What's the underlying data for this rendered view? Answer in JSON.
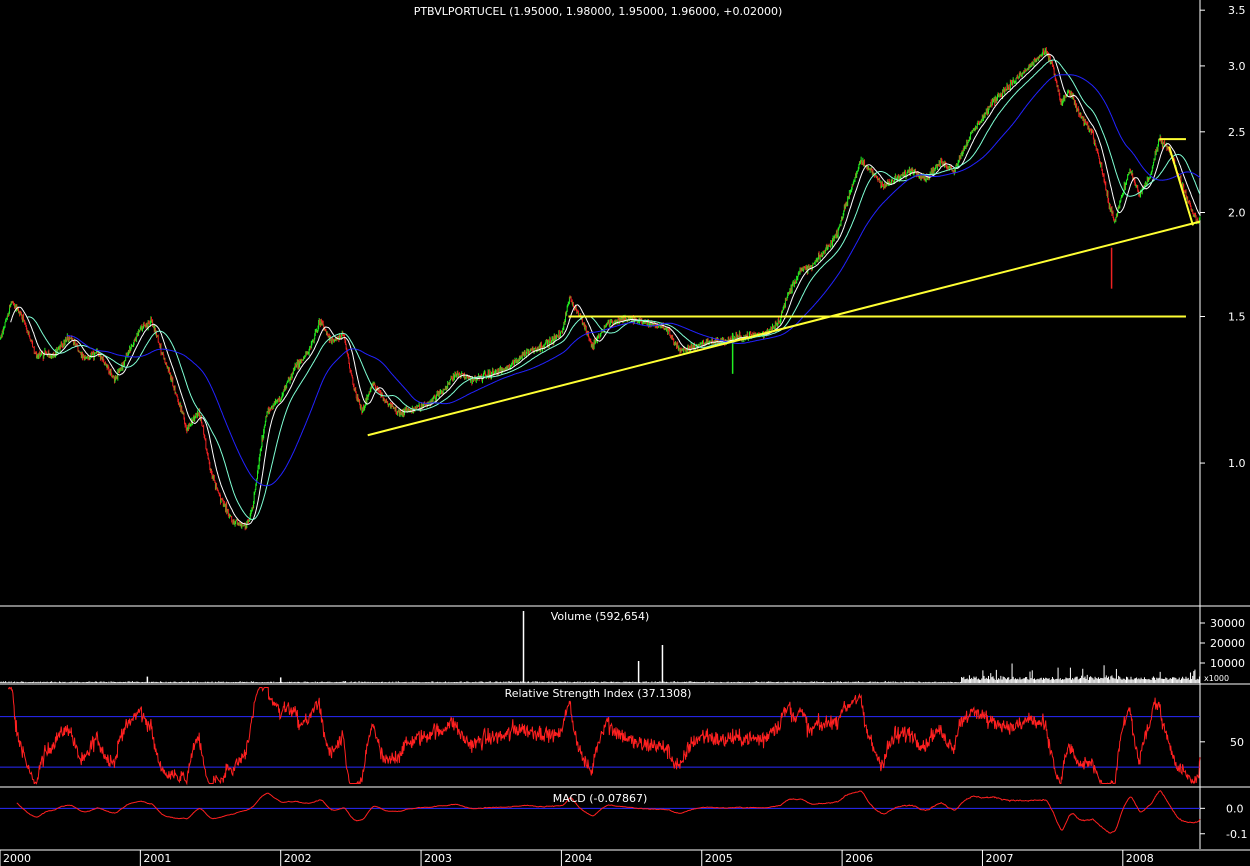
{
  "chart_data": [
    {
      "type": "candlestick",
      "title": "PTBVLPORTUCEL (1.95000, 1.98000, 1.95000, 1.96000, +0.02000)",
      "scale": "log",
      "ylim": [
        0.7,
        3.6
      ],
      "yticks": [
        "3.5",
        "3.0",
        "2.5",
        "2.0",
        "1.5",
        "1.0"
      ],
      "ytick_values": [
        3.5,
        3.0,
        2.5,
        2.0,
        1.5,
        1.0
      ],
      "x_years": [
        "2000",
        "2001",
        "2002",
        "2003",
        "2004",
        "2005",
        "2006",
        "2007",
        "2008"
      ],
      "x_range": [
        2000.0,
        2008.55
      ],
      "price_anchors": [
        [
          2000.0,
          1.4
        ],
        [
          2000.08,
          1.56
        ],
        [
          2000.16,
          1.5
        ],
        [
          2000.25,
          1.35
        ],
        [
          2000.38,
          1.35
        ],
        [
          2000.5,
          1.42
        ],
        [
          2000.6,
          1.33
        ],
        [
          2000.7,
          1.36
        ],
        [
          2000.82,
          1.26
        ],
        [
          2000.92,
          1.36
        ],
        [
          2001.0,
          1.45
        ],
        [
          2001.08,
          1.48
        ],
        [
          2001.16,
          1.35
        ],
        [
          2001.25,
          1.22
        ],
        [
          2001.33,
          1.1
        ],
        [
          2001.42,
          1.15
        ],
        [
          2001.5,
          0.98
        ],
        [
          2001.58,
          0.9
        ],
        [
          2001.66,
          0.85
        ],
        [
          2001.75,
          0.84
        ],
        [
          2001.8,
          0.88
        ],
        [
          2001.9,
          1.15
        ],
        [
          2002.0,
          1.2
        ],
        [
          2002.1,
          1.3
        ],
        [
          2002.2,
          1.36
        ],
        [
          2002.28,
          1.48
        ],
        [
          2002.36,
          1.4
        ],
        [
          2002.45,
          1.42
        ],
        [
          2002.52,
          1.23
        ],
        [
          2002.58,
          1.15
        ],
        [
          2002.66,
          1.25
        ],
        [
          2002.75,
          1.18
        ],
        [
          2002.85,
          1.15
        ],
        [
          2002.95,
          1.16
        ],
        [
          2003.05,
          1.18
        ],
        [
          2003.15,
          1.22
        ],
        [
          2003.25,
          1.28
        ],
        [
          2003.38,
          1.26
        ],
        [
          2003.5,
          1.28
        ],
        [
          2003.62,
          1.3
        ],
        [
          2003.75,
          1.36
        ],
        [
          2003.85,
          1.38
        ],
        [
          2003.92,
          1.4
        ],
        [
          2004.0,
          1.43
        ],
        [
          2004.06,
          1.58
        ],
        [
          2004.15,
          1.48
        ],
        [
          2004.22,
          1.38
        ],
        [
          2004.32,
          1.47
        ],
        [
          2004.45,
          1.49
        ],
        [
          2004.55,
          1.48
        ],
        [
          2004.65,
          1.47
        ],
        [
          2004.75,
          1.45
        ],
        [
          2004.85,
          1.36
        ],
        [
          2004.95,
          1.38
        ],
        [
          2005.05,
          1.4
        ],
        [
          2005.15,
          1.4
        ],
        [
          2005.3,
          1.42
        ],
        [
          2005.45,
          1.43
        ],
        [
          2005.55,
          1.48
        ],
        [
          2005.62,
          1.6
        ],
        [
          2005.7,
          1.7
        ],
        [
          2005.78,
          1.72
        ],
        [
          2005.88,
          1.8
        ],
        [
          2005.96,
          1.88
        ],
        [
          2006.05,
          2.1
        ],
        [
          2006.13,
          2.3
        ],
        [
          2006.2,
          2.25
        ],
        [
          2006.3,
          2.15
        ],
        [
          2006.4,
          2.2
        ],
        [
          2006.5,
          2.25
        ],
        [
          2006.6,
          2.2
        ],
        [
          2006.7,
          2.3
        ],
        [
          2006.8,
          2.25
        ],
        [
          2006.9,
          2.45
        ],
        [
          2007.0,
          2.6
        ],
        [
          2007.1,
          2.75
        ],
        [
          2007.2,
          2.85
        ],
        [
          2007.3,
          2.95
        ],
        [
          2007.38,
          3.05
        ],
        [
          2007.45,
          3.12
        ],
        [
          2007.5,
          3.0
        ],
        [
          2007.56,
          2.7
        ],
        [
          2007.62,
          2.8
        ],
        [
          2007.7,
          2.6
        ],
        [
          2007.78,
          2.5
        ],
        [
          2007.84,
          2.3
        ],
        [
          2007.9,
          2.05
        ],
        [
          2007.94,
          1.95
        ],
        [
          2007.98,
          2.05
        ],
        [
          2008.05,
          2.25
        ],
        [
          2008.12,
          2.1
        ],
        [
          2008.2,
          2.22
        ],
        [
          2008.26,
          2.45
        ],
        [
          2008.32,
          2.4
        ],
        [
          2008.38,
          2.25
        ],
        [
          2008.45,
          2.1
        ],
        [
          2008.52,
          1.96
        ]
      ],
      "moving_average_colors": [
        "#ffffff",
        "#7fffd4",
        "#2222ff"
      ],
      "trendlines": [
        {
          "x": [
            2002.62,
            2008.55
          ],
          "y": [
            1.08,
            1.95
          ],
          "color": "#ffff33"
        },
        {
          "x": [
            2004.05,
            2008.45
          ],
          "y": [
            1.5,
            1.5
          ],
          "color": "#ffff33"
        },
        {
          "x": [
            2008.26,
            2008.45
          ],
          "y": [
            2.45,
            2.45
          ],
          "color": "#ffff33"
        },
        {
          "x": [
            2008.33,
            2008.5
          ],
          "y": [
            2.4,
            1.93
          ],
          "color": "#ffff33"
        }
      ],
      "up_color": "#22ee22",
      "down_color": "#ee2222"
    },
    {
      "type": "bar",
      "title": "Volume (592,654)",
      "yticks": [
        "30000",
        "20000",
        "10000"
      ],
      "ytick_values": [
        30000,
        20000,
        10000
      ],
      "ylim": [
        0,
        38000
      ],
      "unit_label": "x1000",
      "spikes": [
        [
          2003.73,
          36000
        ],
        [
          2004.55,
          11000
        ],
        [
          2004.72,
          19000
        ],
        [
          2001.05,
          3200
        ],
        [
          2002.0,
          2800
        ]
      ],
      "high_volume_period": [
        2006.85,
        2008.55
      ],
      "color": "#ffffff"
    },
    {
      "type": "line",
      "title": "Relative Strength Index (37.1308)",
      "yticks": [
        "50"
      ],
      "ytick_values": [
        50
      ],
      "ylim": [
        15,
        95
      ],
      "bands": [
        70,
        30
      ],
      "last_value": 37.1308,
      "color": "#ff2020",
      "band_color": "#2a2aff"
    },
    {
      "type": "line",
      "title": "MACD (-0.07867)",
      "yticks": [
        "0.0",
        "-0.1"
      ],
      "ytick_values": [
        0.0,
        -0.1
      ],
      "ylim": [
        -0.16,
        0.08
      ],
      "last_value": -0.07867,
      "color": "#ff2020",
      "zero_line_color": "#2a2aff"
    }
  ]
}
